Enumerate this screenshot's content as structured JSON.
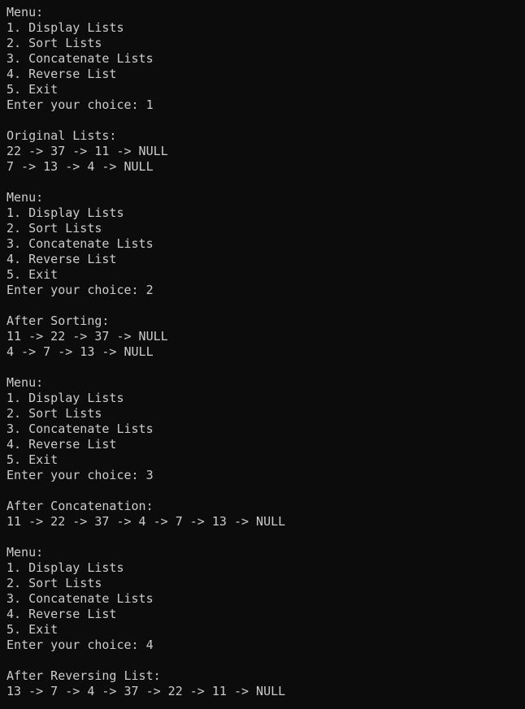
{
  "terminal": {
    "lines": [
      "Menu:",
      "1. Display Lists",
      "2. Sort Lists",
      "3. Concatenate Lists",
      "4. Reverse List",
      "5. Exit",
      "Enter your choice: 1",
      "",
      "Original Lists:",
      "22 -> 37 -> 11 -> NULL",
      "7 -> 13 -> 4 -> NULL",
      "",
      "Menu:",
      "1. Display Lists",
      "2. Sort Lists",
      "3. Concatenate Lists",
      "4. Reverse List",
      "5. Exit",
      "Enter your choice: 2",
      "",
      "After Sorting:",
      "11 -> 22 -> 37 -> NULL",
      "4 -> 7 -> 13 -> NULL",
      "",
      "Menu:",
      "1. Display Lists",
      "2. Sort Lists",
      "3. Concatenate Lists",
      "4. Reverse List",
      "5. Exit",
      "Enter your choice: 3",
      "",
      "After Concatenation:",
      "11 -> 22 -> 37 -> 4 -> 7 -> 13 -> NULL",
      "",
      "Menu:",
      "1. Display Lists",
      "2. Sort Lists",
      "3. Concatenate Lists",
      "4. Reverse List",
      "5. Exit",
      "Enter your choice: 4",
      "",
      "After Reversing List:",
      "13 -> 7 -> 4 -> 37 -> 22 -> 11 -> NULL"
    ]
  },
  "colors": {
    "background": "#0c0c0c",
    "foreground": "#cccccc"
  }
}
